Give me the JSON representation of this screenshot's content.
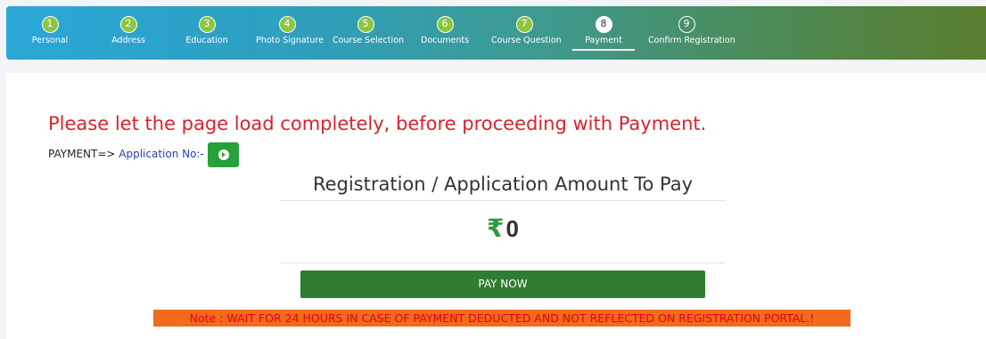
{
  "wizard": {
    "steps": [
      {
        "num": "1",
        "label": "Personal"
      },
      {
        "num": "2",
        "label": "Address"
      },
      {
        "num": "3",
        "label": "Education"
      },
      {
        "num": "4",
        "label": "Photo Signature"
      },
      {
        "num": "5",
        "label": "Course Selection"
      },
      {
        "num": "6",
        "label": "Documents"
      },
      {
        "num": "7",
        "label": "Course Question"
      },
      {
        "num": "8",
        "label": "Payment"
      },
      {
        "num": "9",
        "label": "Confirm Registration"
      }
    ],
    "active_step": "8"
  },
  "payment": {
    "warning": "Please let the page load completely, before proceeding with Payment.",
    "prefix": "PAYMENT=> ",
    "application_label": "Application No:-",
    "amount_title": "Registration / Application Amount To Pay",
    "currency_symbol": "₹",
    "amount": "0",
    "pay_button": "PAY NOW",
    "note": "Note : WAIT FOR 24 HOURS IN CASE OF PAYMENT DEDUCTED AND NOT REFLECTED ON REGISTRATION PORTAL.!"
  },
  "colors": {
    "warning_text": "#d9232b",
    "pay_button": "#2e7d32",
    "note_background": "#f26a1b",
    "completed_step": "#8cc63f"
  },
  "icons": {
    "refresh_button": "play-circle-icon"
  }
}
